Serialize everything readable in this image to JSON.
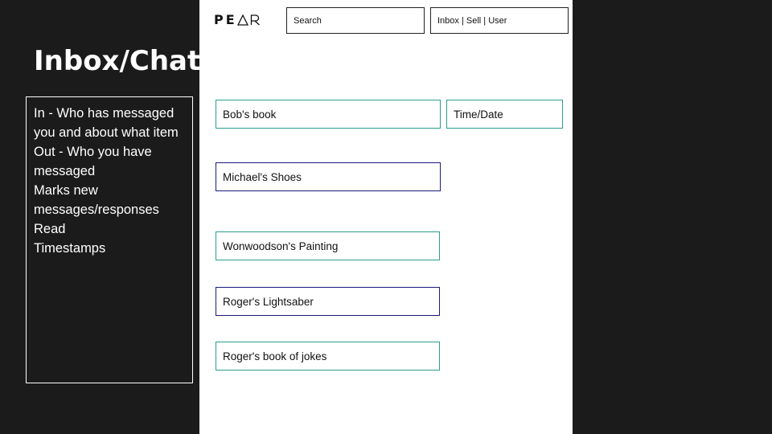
{
  "slide": {
    "title": "Inbox/Chat",
    "notes": [
      "In - Who has messaged you and about what item",
      "Out - Who you have messaged",
      "Marks new messages/responses",
      "Read",
      "Timestamps"
    ]
  },
  "mockup": {
    "logo_text": "PEAR",
    "search": {
      "label": "Search"
    },
    "nav": {
      "label": "Inbox | Sell | User"
    },
    "header_row": {
      "item": "Bob's book",
      "time": "Time/Date"
    },
    "rows": [
      {
        "label": "Michael's Shoes"
      },
      {
        "label": "Wonwoodson's Painting"
      },
      {
        "label": "Roger's Lightsaber"
      },
      {
        "label": "Roger's book of jokes"
      }
    ]
  },
  "colors": {
    "background": "#1b1b1b",
    "teal_border": "#2a9d8f",
    "navy_border": "#1a1a7a"
  }
}
